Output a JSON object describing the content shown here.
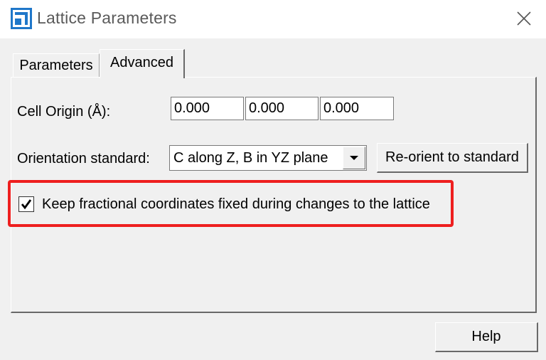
{
  "window": {
    "title": "Lattice Parameters",
    "app_icon": "lattice-window-icon",
    "close_icon": "close-icon"
  },
  "tabs": [
    {
      "label": "Parameters",
      "active": false
    },
    {
      "label": "Advanced",
      "active": true
    }
  ],
  "advanced": {
    "cell_origin_label": "Cell Origin (Å):",
    "cell_origin_values": [
      "0.000",
      "0.000",
      "0.000"
    ],
    "orientation_label": "Orientation standard:",
    "orientation_selected": "C along Z, B in YZ plane",
    "reorient_button": "Re-orient to standard",
    "keep_fractional_label": "Keep fractional coordinates fixed during changes to the lattice",
    "keep_fractional_checked": true
  },
  "footer": {
    "help_button": "Help"
  },
  "colors": {
    "highlight": "#ee1f1f",
    "window_bg": "#f0f0f0",
    "title_text": "#5a5a5a"
  }
}
